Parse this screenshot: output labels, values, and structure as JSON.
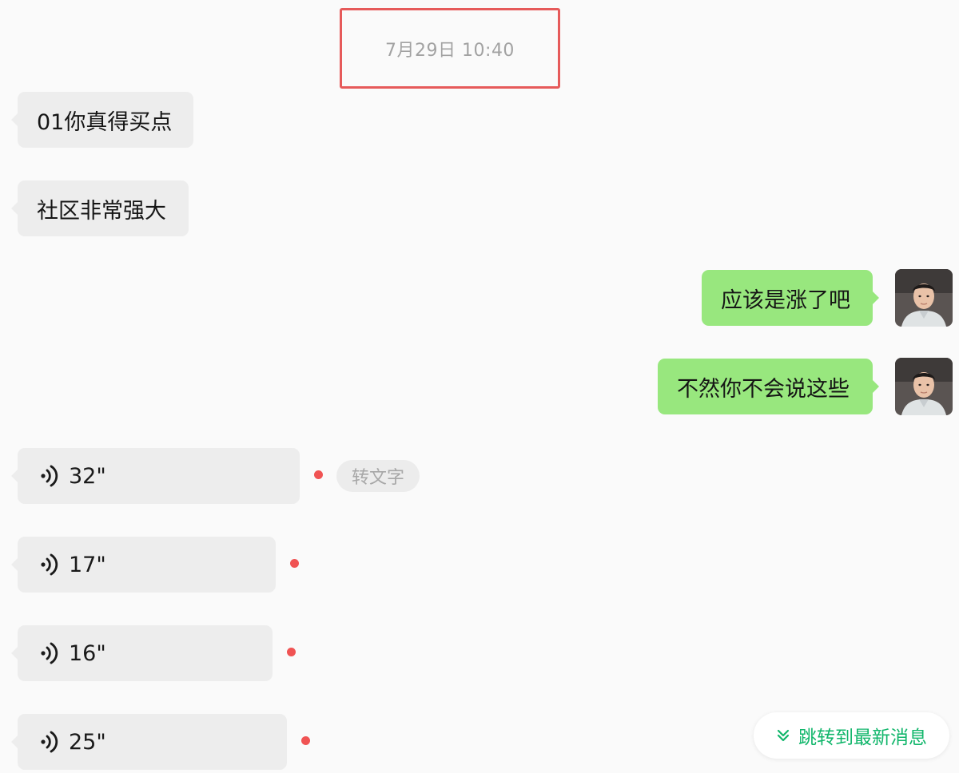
{
  "timestamp": "7月29日 10:40",
  "messages": [
    {
      "side": "in",
      "type": "text",
      "text": "01你真得买点"
    },
    {
      "side": "in",
      "type": "text",
      "text": "社区非常强大"
    },
    {
      "side": "out",
      "type": "text",
      "text": "应该是涨了吧"
    },
    {
      "side": "out",
      "type": "text",
      "text": "不然你不会说这些"
    },
    {
      "side": "in",
      "type": "voice",
      "duration": "32\"",
      "unread": true,
      "action": "转文字"
    },
    {
      "side": "in",
      "type": "voice",
      "duration": "17\"",
      "unread": true
    },
    {
      "side": "in",
      "type": "voice",
      "duration": "16\"",
      "unread": true
    },
    {
      "side": "in",
      "type": "voice",
      "duration": "25\"",
      "unread": true
    }
  ],
  "jump_button": {
    "label": "跳转到最新消息",
    "icon": "double-chevron-down-icon"
  },
  "colors": {
    "incoming_bubble": "#ededed",
    "outgoing_bubble": "#98e77e",
    "accent": "#11b66b",
    "unread": "#f05353",
    "highlight_frame": "#e65a5a"
  }
}
